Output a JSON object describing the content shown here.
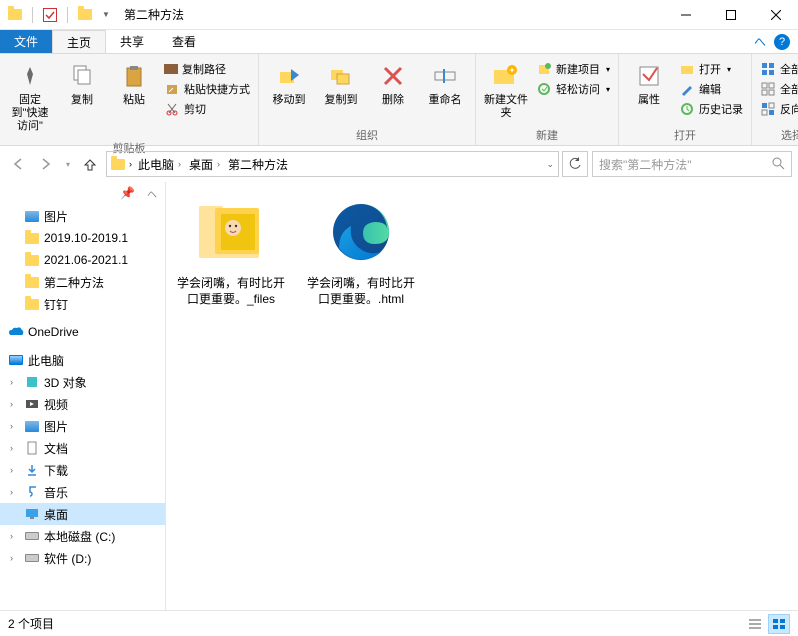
{
  "titlebar": {
    "title": "第二种方法"
  },
  "tabs": {
    "file": "文件",
    "home": "主页",
    "share": "共享",
    "view": "查看"
  },
  "ribbon": {
    "pin": "固定到\"快速访问\"",
    "copy": "复制",
    "paste": "粘贴",
    "copy_path": "复制路径",
    "paste_shortcut": "粘贴快捷方式",
    "cut": "剪切",
    "group_clipboard": "剪贴板",
    "move_to": "移动到",
    "copy_to": "复制到",
    "delete": "删除",
    "rename": "重命名",
    "group_organize": "组织",
    "new_folder": "新建文件夹",
    "new_item": "新建项目",
    "easy_access": "轻松访问",
    "group_new": "新建",
    "properties": "属性",
    "open": "打开",
    "edit": "编辑",
    "history": "历史记录",
    "group_open": "打开",
    "select_all": "全部选择",
    "select_none": "全部取消",
    "invert_sel": "反向选择",
    "group_select": "选择"
  },
  "breadcrumb": {
    "c1": "此电脑",
    "c2": "桌面",
    "c3": "第二种方法"
  },
  "search": {
    "placeholder": "搜索\"第二种方法\""
  },
  "sidebar": {
    "pictures": "图片",
    "f1": "2019.10-2019.1",
    "f2": "2021.06-2021.1",
    "f3": "第二种方法",
    "f4": "钉钉",
    "onedrive": "OneDrive",
    "this_pc": "此电脑",
    "s3d": "3D 对象",
    "svideo": "视频",
    "spic": "图片",
    "sdoc": "文档",
    "sdl": "下载",
    "smusic": "音乐",
    "sdesktop": "桌面",
    "sdiskc": "本地磁盘 (C:)",
    "sdiskd": "软件 (D:)"
  },
  "files": {
    "item1": "学会闭嘴，有时比开口更重要。_files",
    "item2": "学会闭嘴，有时比开口更重要。.html"
  },
  "status": {
    "count": "2 个项目"
  }
}
